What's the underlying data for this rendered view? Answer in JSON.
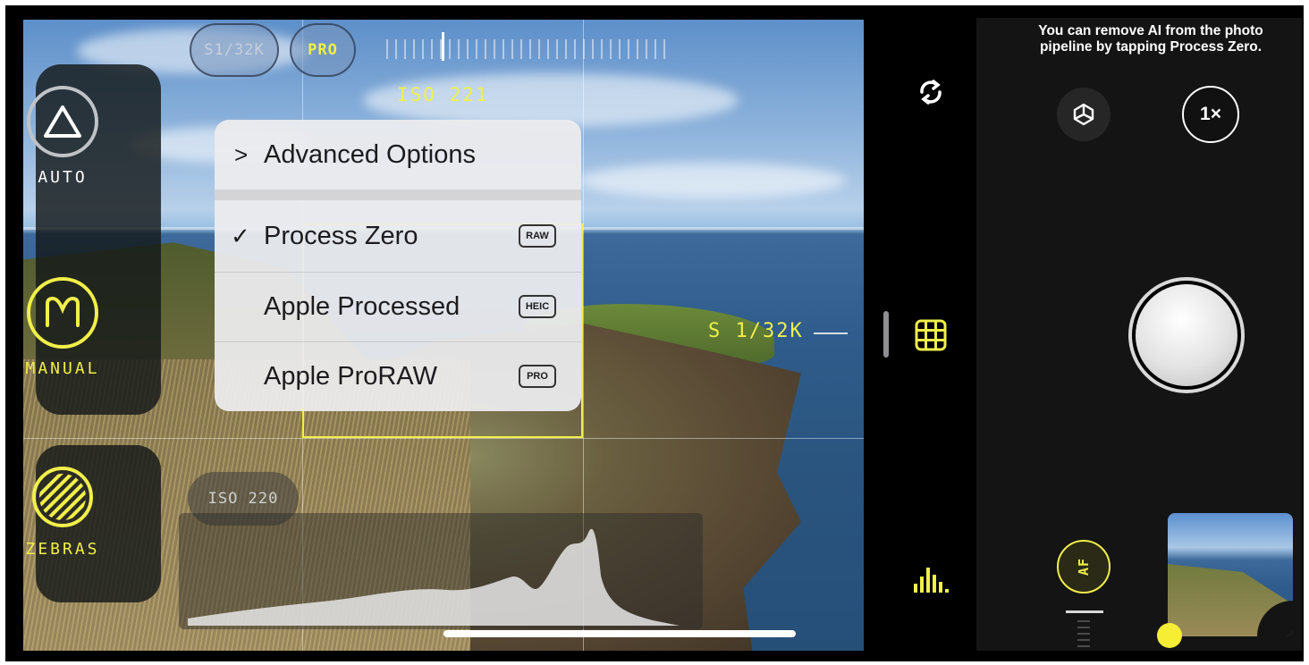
{
  "caption": "You can remove AI from the photo pipeline by tapping Process Zero.",
  "top_bar": {
    "shutter_pill": "S1/32K",
    "pro_pill": "PRO",
    "iso_value": "ISO 221"
  },
  "modes": [
    {
      "label": "AUTO",
      "icon": "triangle-icon",
      "color": "#ffffff"
    },
    {
      "label": "MANUAL",
      "icon": "m-icon",
      "color": "#f1ef4a"
    },
    {
      "label": "ZEBRAS",
      "icon": "zebras-icon",
      "color": "#f1ef4a"
    }
  ],
  "menu": {
    "advanced": "Advanced Options",
    "items": [
      {
        "label": "Process Zero",
        "badge": "RAW",
        "checked": true
      },
      {
        "label": "Apple Processed",
        "badge": "HEIC",
        "checked": false
      },
      {
        "label": "Apple ProRAW",
        "badge": "PRO",
        "checked": false
      }
    ],
    "chevron": ">",
    "check": "✓"
  },
  "shutter_readout": "S 1/32K",
  "iso_bottom": "ISO 220",
  "right": {
    "lens_button": "1×",
    "af_label": "AF"
  },
  "colors": {
    "accent": "#f1ef4a",
    "panel": "#141414"
  }
}
